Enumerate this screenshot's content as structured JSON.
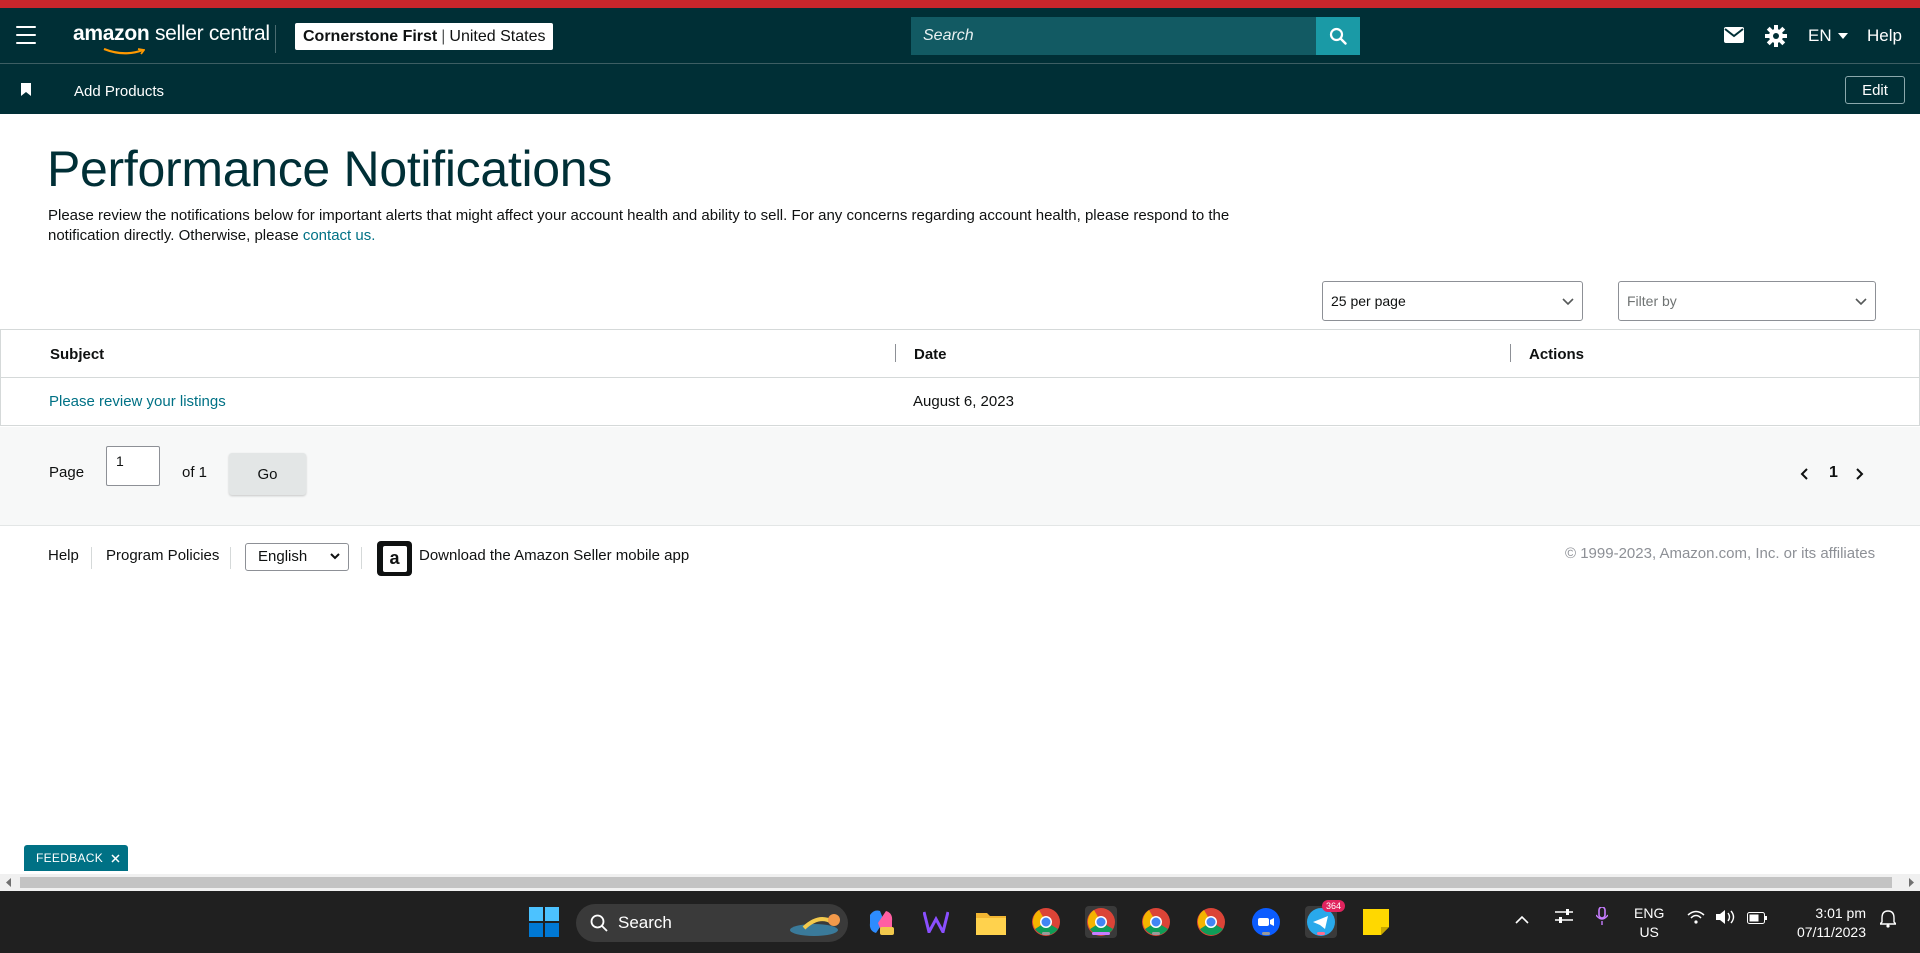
{
  "header": {
    "logo_text": "amazon",
    "logo_sub": "seller central",
    "store_name": "Cornerstone First",
    "store_region": "United States",
    "search_placeholder": "Search",
    "lang": "EN",
    "help": "Help"
  },
  "subnav": {
    "add_products": "Add Products",
    "edit": "Edit"
  },
  "page": {
    "title": "Performance Notifications",
    "description": "Please review the notifications below for important alerts that might affect your account health and ability to sell. For any concerns regarding account health, please respond to the notification directly. Otherwise, please",
    "contact_link": "contact us."
  },
  "controls": {
    "per_page": "25 per page",
    "filter_placeholder": "Filter by"
  },
  "table": {
    "columns": [
      "Subject",
      "Date",
      "Actions"
    ],
    "rows": [
      {
        "subject": "Please review your listings",
        "date": "August 6, 2023",
        "actions": ""
      }
    ]
  },
  "pagination": {
    "page_label": "Page",
    "current": "1",
    "of_label": "of 1",
    "go": "Go",
    "page_num": "1"
  },
  "footer": {
    "help": "Help",
    "policies": "Program Policies",
    "language": "English",
    "app_text": "Download the Amazon Seller mobile app",
    "copyright": "© 1999-2023, Amazon.com, Inc. or its affiliates"
  },
  "feedback": "FEEDBACK",
  "taskbar": {
    "search": "Search",
    "lang_line1": "ENG",
    "lang_line2": "US",
    "time": "3:01 pm",
    "date": "07/11/2023",
    "telegram_badge": "364"
  },
  "colors": {
    "nav_bg": "#002f36",
    "accent_stripe": "#c8262c",
    "link": "#007185",
    "search_button": "#1a9aa6"
  }
}
